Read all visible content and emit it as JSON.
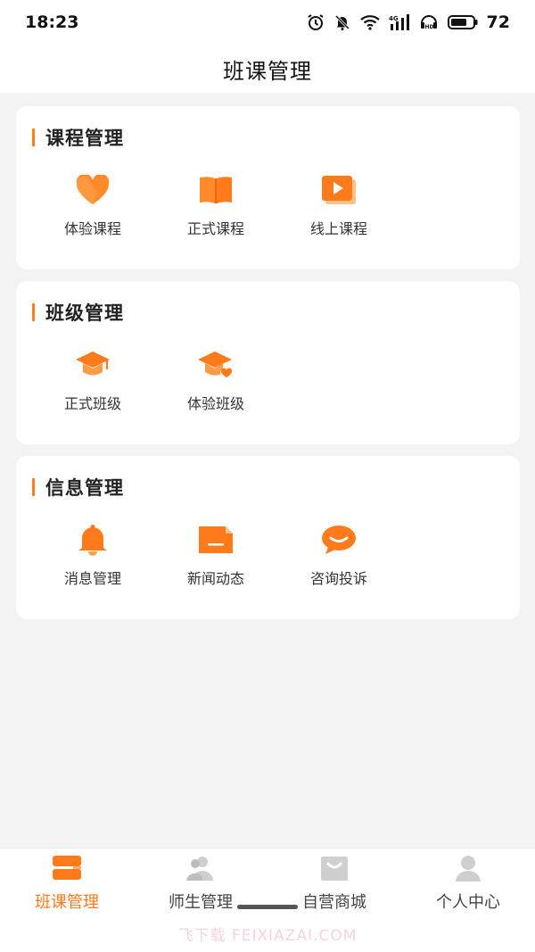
{
  "status_bar": {
    "time": "18:23",
    "battery_level": "72",
    "icons": [
      "alarm-icon",
      "mute-icon",
      "wifi-icon",
      "signal-4g-icon",
      "hd-icon",
      "battery-icon"
    ]
  },
  "header": {
    "title": "班课管理"
  },
  "accent_color": "#ff7a1a",
  "sections": [
    {
      "title": "课程管理",
      "items": [
        {
          "label": "体验课程",
          "icon": "heart-icon"
        },
        {
          "label": "正式课程",
          "icon": "book-icon"
        },
        {
          "label": "线上课程",
          "icon": "video-play-icon"
        }
      ]
    },
    {
      "title": "班级管理",
      "items": [
        {
          "label": "正式班级",
          "icon": "graduation-cap-icon"
        },
        {
          "label": "体验班级",
          "icon": "graduation-cap-heart-icon"
        }
      ]
    },
    {
      "title": "信息管理",
      "items": [
        {
          "label": "消息管理",
          "icon": "bell-icon"
        },
        {
          "label": "新闻动态",
          "icon": "news-icon"
        },
        {
          "label": "咨询投诉",
          "icon": "chat-bubble-icon"
        }
      ]
    }
  ],
  "tabbar": {
    "tabs": [
      {
        "label": "班课管理",
        "icon": "classes-icon",
        "active": true
      },
      {
        "label": "师生管理",
        "icon": "people-icon",
        "active": false
      },
      {
        "label": "自营商城",
        "icon": "shopping-bag-icon",
        "active": false
      },
      {
        "label": "个人中心",
        "icon": "person-icon",
        "active": false
      }
    ]
  },
  "watermark": "飞下载 FEIXIAZAI.COM"
}
